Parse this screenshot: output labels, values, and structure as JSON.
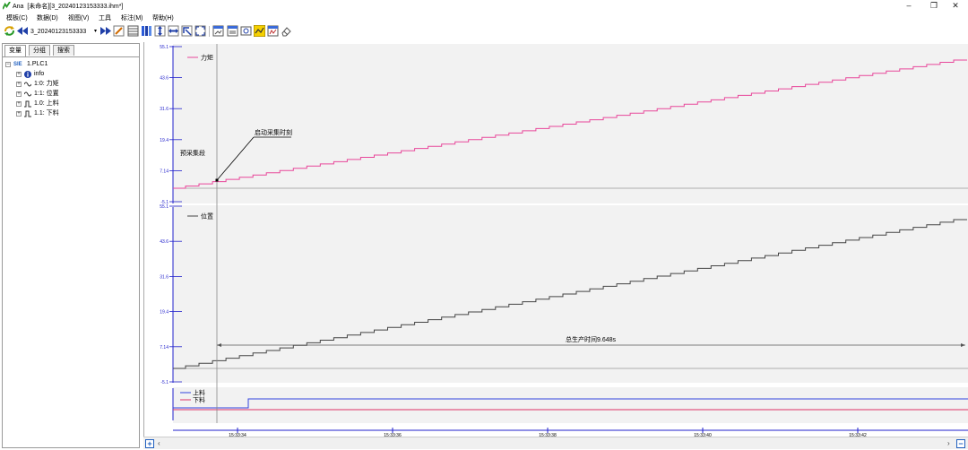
{
  "window": {
    "app_name": "Ana",
    "title": "[未命名][3_20240123153333.ihm*]",
    "minimize": "–",
    "maximize": "❐",
    "close": "✕"
  },
  "menu": [
    "模板(C)",
    "数据(D)",
    "视图(V)",
    "工具",
    "标注(M)",
    "帮助(H)"
  ],
  "toolbar": {
    "file_name": "3_20240123153333",
    "dropdown_arrow": "▾",
    "icons": [
      "refresh-icon",
      "rewind-icon",
      "fast-forward-icon",
      "edit-icon",
      "grid-icon",
      "color-bars-icon",
      "vertical-expand-icon",
      "horizontal-expand-icon",
      "zoom-area-icon",
      "fit-icon",
      "chart-window-icon",
      "chart-window-alt-icon",
      "screenshot-icon",
      "highlight-icon",
      "chart-export-icon",
      "eraser-icon"
    ]
  },
  "left_panel": {
    "tabs": [
      "变量",
      "分组",
      "搜索"
    ],
    "tree": {
      "root": {
        "badge": "SIE",
        "label": "1.PLC1"
      },
      "children": [
        {
          "label": "info",
          "icon": "info-icon"
        },
        {
          "label": "1:0: 力矩",
          "icon": "analog-signal-icon"
        },
        {
          "label": "1:1: 位置",
          "icon": "analog-signal-icon"
        },
        {
          "label": "1.0: 上料",
          "icon": "digital-signal-icon"
        },
        {
          "label": "1.1: 下料",
          "icon": "digital-signal-icon"
        }
      ]
    }
  },
  "chart": {
    "colors": {
      "torque": "#e8479a",
      "position": "#444444",
      "load": "#3344dd",
      "unload": "#dd3366",
      "axis": "#2222cc",
      "cursor": "#888888"
    },
    "panels": [
      {
        "signal": "力矩",
        "ticks": [
          "55.1",
          "43.6",
          "31.6",
          "19.4",
          "7.14",
          "-5.1"
        ]
      },
      {
        "signal": "位置",
        "ticks": [
          "55.1",
          "43.6",
          "31.6",
          "19.4",
          "7.14",
          "-5.1"
        ]
      }
    ],
    "digital_legend": [
      "上料",
      "下料"
    ],
    "annotations": {
      "trigger": "启动采集时刻",
      "pretrigger": "预采集段",
      "measurement": "总生产时间9.648s"
    },
    "time_axis": [
      "15:33:34",
      "15:33:36",
      "15:33:38",
      "15:33:40",
      "15:33:42"
    ]
  },
  "bottom": {
    "zoom_in": "+",
    "zoom_out": "−",
    "scroll_left": "‹",
    "scroll_right": "›"
  }
}
